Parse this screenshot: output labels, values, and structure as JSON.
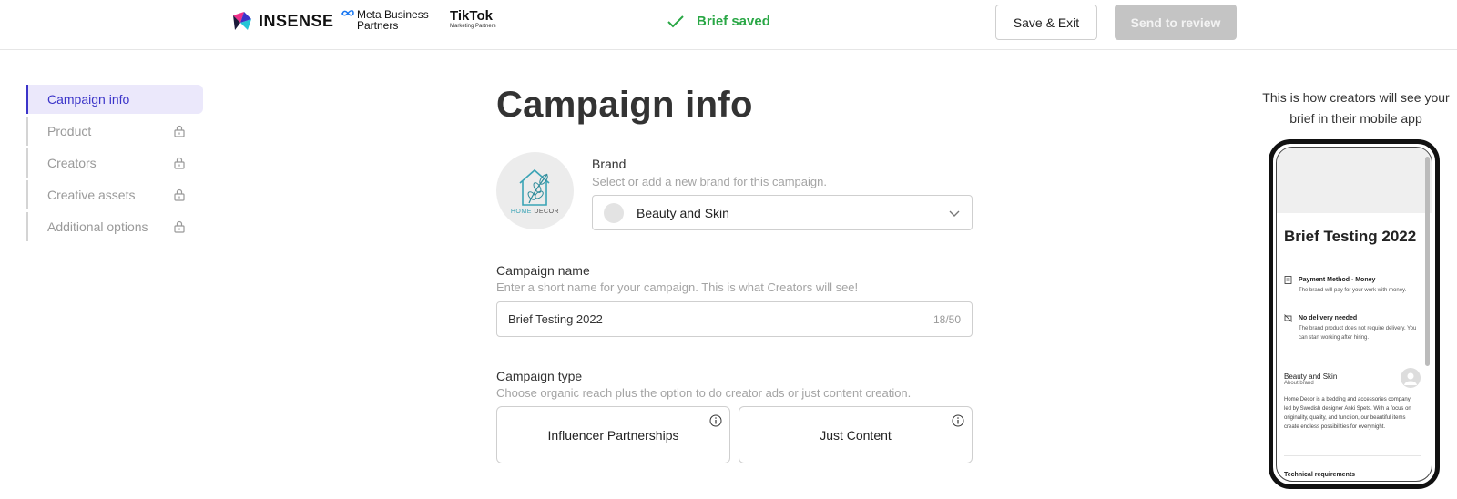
{
  "header": {
    "insense_logo": "INSENSE",
    "meta_logo": [
      "Meta Business",
      "Partners"
    ],
    "tiktok_logo": "TikTok",
    "tiktok_sub": "Marketing Partners",
    "status": "Brief saved",
    "save_exit": "Save & Exit",
    "send_review": "Send to review",
    "colors": {
      "status": "#29a745",
      "disabled_button": "#c4c4c4"
    }
  },
  "sidebar": {
    "items": [
      {
        "label": "Campaign info",
        "active": true,
        "locked": false
      },
      {
        "label": "Product",
        "active": false,
        "locked": true
      },
      {
        "label": "Creators",
        "active": false,
        "locked": true
      },
      {
        "label": "Creative assets",
        "active": false,
        "locked": true
      },
      {
        "label": "Additional options",
        "active": false,
        "locked": true
      }
    ],
    "accent_color": "#3b34c9"
  },
  "main": {
    "title": "Campaign info",
    "brand_logo_text": [
      "HOME",
      "DECOR"
    ],
    "brand": {
      "label": "Brand",
      "hint": "Select or add a new brand for this campaign.",
      "selected": "Beauty and Skin"
    },
    "campaign_name": {
      "label": "Campaign name",
      "hint": "Enter a short name for your campaign. This is what Creators will see!",
      "value": "Brief Testing 2022",
      "counter": "18/50"
    },
    "campaign_type": {
      "label": "Campaign type",
      "hint": "Choose organic reach plus the option to do creator ads or just content creation.",
      "options": [
        "Influencer Partnerships",
        "Just Content"
      ]
    }
  },
  "preview": {
    "hint": "This is how creators will see your brief in their mobile app",
    "title": "Brief Testing 2022",
    "payment_title": "Payment Method - Money",
    "payment_desc": "The brand will pay for your work with money.",
    "delivery_title": "No delivery needed",
    "delivery_desc": "The brand product does not require delivery. You can start working after hiring.",
    "brand_name": "Beauty and Skin",
    "brand_sub": "About brand",
    "brand_desc": "Home Decor is a bedding and accessories company led by Swedish designer Anki Spets. With a focus on originality, quality, and function, our beautiful items create endless possibilities for everynight.",
    "tech_title": "Technical requirements"
  }
}
